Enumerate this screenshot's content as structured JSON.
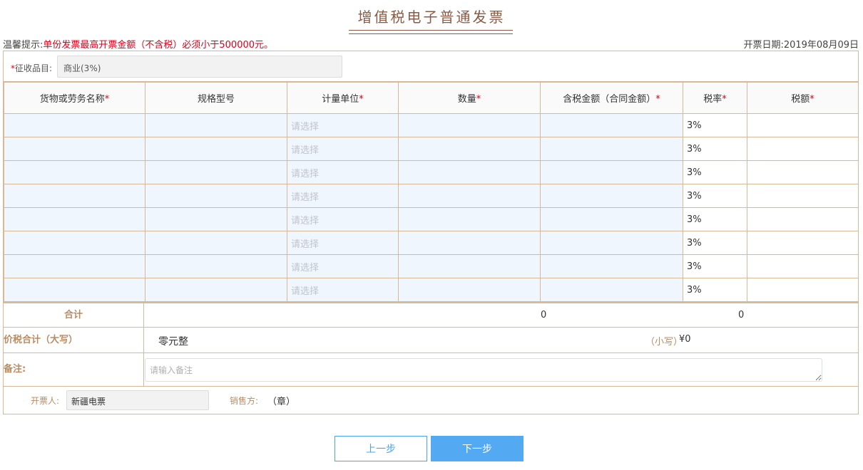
{
  "title": "增值税电子普通发票",
  "tip": {
    "label": "温馨提示:",
    "text": "单份发票最高开票金额（不含税）必须小于500000元。"
  },
  "date": {
    "label": "开票日期:",
    "value": "2019年08月09日"
  },
  "category": {
    "label": "征收品目:",
    "value": "商业(3%)"
  },
  "columns": [
    {
      "label": "货物或劳务名称",
      "required": "*"
    },
    {
      "label": "规格型号",
      "required": ""
    },
    {
      "label": "计量单位",
      "required": "*"
    },
    {
      "label": "数量",
      "required": "*"
    },
    {
      "label": "含税金额（合同金额）",
      "required": "*"
    },
    {
      "label": "税率",
      "required": "*"
    },
    {
      "label": "税额",
      "required": "*"
    }
  ],
  "rows": [
    {
      "unit_placeholder": "请选择",
      "rate": "3%"
    },
    {
      "unit_placeholder": "请选择",
      "rate": "3%"
    },
    {
      "unit_placeholder": "请选择",
      "rate": "3%"
    },
    {
      "unit_placeholder": "请选择",
      "rate": "3%"
    },
    {
      "unit_placeholder": "请选择",
      "rate": "3%"
    },
    {
      "unit_placeholder": "请选择",
      "rate": "3%"
    },
    {
      "unit_placeholder": "请选择",
      "rate": "3%"
    },
    {
      "unit_placeholder": "请选择",
      "rate": "3%"
    }
  ],
  "summary": {
    "label": "合计",
    "amount": "0",
    "tax": "0"
  },
  "total": {
    "label": "价税合计（大写）",
    "upper": "零元整",
    "small_label": "（小写）",
    "small": "¥0"
  },
  "note": {
    "label": "备注:",
    "placeholder": "请输入备注"
  },
  "issuer": {
    "label": "开票人:",
    "value": "新疆电票"
  },
  "seller": {
    "label": "销售方:",
    "value": "（章）"
  },
  "buttons": {
    "prev": "上一步",
    "next": "下一步"
  },
  "colors": {
    "border": "#d6b998",
    "label_brown": "#b78c65",
    "title_brown": "#8a5a44",
    "warning_red": "#d9001b",
    "input_blue_bg": "#f0f6fd",
    "primary_blue": "#53aaf3"
  }
}
